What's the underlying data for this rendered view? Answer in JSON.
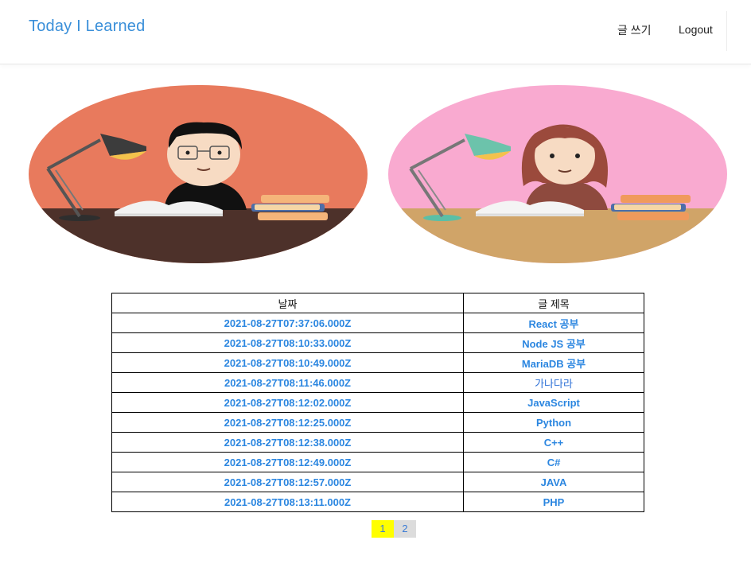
{
  "navbar": {
    "brand": "Today I Learned",
    "write_label": "글 쓰기",
    "logout_label": "Logout"
  },
  "table": {
    "headers": [
      "날짜",
      "글 제목"
    ],
    "rows": [
      {
        "date": "2021-08-27T07:37:06.000Z",
        "title": "React 공부"
      },
      {
        "date": "2021-08-27T08:10:33.000Z",
        "title": "Node JS 공부"
      },
      {
        "date": "2021-08-27T08:10:49.000Z",
        "title": "MariaDB 공부"
      },
      {
        "date": "2021-08-27T08:11:46.000Z",
        "title": "가나다라"
      },
      {
        "date": "2021-08-27T08:12:02.000Z",
        "title": "JavaScript"
      },
      {
        "date": "2021-08-27T08:12:25.000Z",
        "title": "Python"
      },
      {
        "date": "2021-08-27T08:12:38.000Z",
        "title": "C++"
      },
      {
        "date": "2021-08-27T08:12:49.000Z",
        "title": "C#"
      },
      {
        "date": "2021-08-27T08:12:57.000Z",
        "title": "JAVA"
      },
      {
        "date": "2021-08-27T08:13:11.000Z",
        "title": "PHP"
      }
    ]
  },
  "pagination": {
    "pages": [
      "1",
      "2"
    ],
    "current": "1"
  },
  "colors": {
    "brand": "#3a8fd9",
    "link": "#2b86e0",
    "active_page": "#ffff00",
    "inactive_page": "#dcdcdc",
    "left_hero_bg": "#e87a5d",
    "right_hero_bg": "#f9aad0"
  }
}
